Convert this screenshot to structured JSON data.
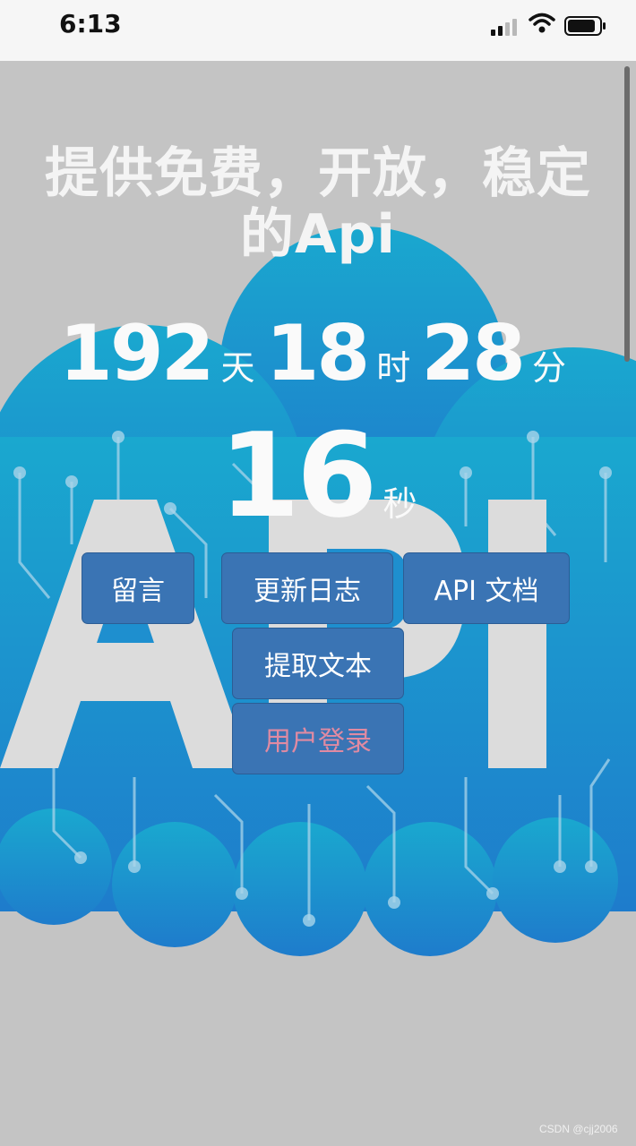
{
  "status_bar": {
    "time": "6:13",
    "icons": [
      "cellular-signal-icon",
      "wifi-icon",
      "battery-icon"
    ]
  },
  "hero": {
    "headline": "提供免费，开放，稳定的Api",
    "background": "cloud-api-circuit-illustration"
  },
  "countdown": {
    "days": "192",
    "days_unit": "天",
    "hours": "18",
    "hours_unit": "时",
    "minutes": "28",
    "minutes_unit": "分",
    "seconds": "16",
    "seconds_unit": "秒"
  },
  "buttons": {
    "message": "留言",
    "changelog": "更新日志",
    "api_docs": "API 文档",
    "extract_text": "提取文本",
    "user_login": "用户登录"
  },
  "watermark": "CSDN @cjj2006",
  "colors": {
    "button_bg": "#3a74b4",
    "login_text": "#e08aa2",
    "page_bg": "#c4c4c4"
  }
}
